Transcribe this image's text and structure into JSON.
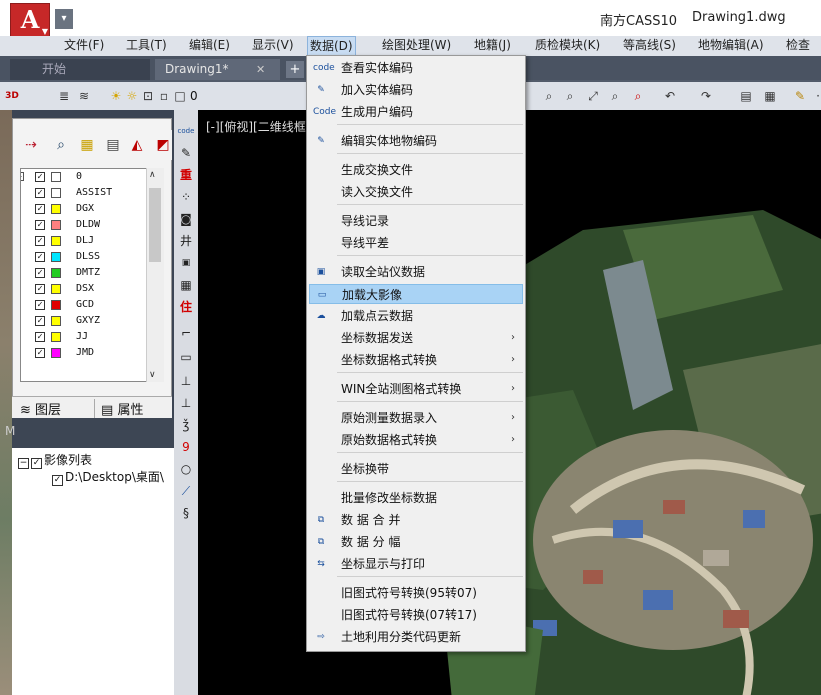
{
  "title_bar": {
    "app_name": "南方CASS10",
    "document": "Drawing1.dwg",
    "app_letter": "A"
  },
  "menu_bar": [
    "文件(F)",
    "工具(T)",
    "编辑(E)",
    "显示(V)",
    "数据(D)",
    "绘图处理(W)",
    "地籍(J)",
    "质检模块(K)",
    "等高线(S)",
    "地物编辑(A)",
    "检查入"
  ],
  "tabs": {
    "start": "开始",
    "drawing": "Drawing1*",
    "close": "✕",
    "add": "+"
  },
  "toolbar": {
    "layer_value": "0"
  },
  "layers": [
    {
      "name": "0",
      "color": "#ffffff"
    },
    {
      "name": "ASSIST",
      "color": "#ffffff"
    },
    {
      "name": "DGX",
      "color": "#ffff00"
    },
    {
      "name": "DLDW",
      "color": "#ff8080"
    },
    {
      "name": "DLJ",
      "color": "#ffff00"
    },
    {
      "name": "DLSS",
      "color": "#00e5ff"
    },
    {
      "name": "DMTZ",
      "color": "#22cc22"
    },
    {
      "name": "DSX",
      "color": "#ffff00"
    },
    {
      "name": "GCD",
      "color": "#e00000"
    },
    {
      "name": "GXYZ",
      "color": "#ffff00"
    },
    {
      "name": "JJ",
      "color": "#ffff00"
    },
    {
      "name": "JMD",
      "color": "#ff00ff"
    }
  ],
  "panel_tabs": {
    "layers": "图层",
    "properties": "属性"
  },
  "panel_gap_label": "M",
  "image_panel": {
    "root": "影像列表",
    "item": "D:\\Desktop\\桌面\\"
  },
  "canvas": {
    "view_label": "[-][俯视][二维线框]"
  },
  "dropdown": {
    "items": [
      {
        "label": "查看实体编码",
        "icon": "code-search-icon",
        "icon_glyph": "code"
      },
      {
        "label": "加入实体编码",
        "icon": "code-add-icon",
        "icon_glyph": "✎"
      },
      {
        "label": "生成用户编码",
        "icon": "code-generate-icon",
        "icon_glyph": "Code"
      },
      {
        "label": "编辑实体地物编码",
        "icon": "code-edit-icon",
        "icon_glyph": "✎"
      },
      {
        "label": "生成交换文件",
        "icon": "",
        "icon_glyph": ""
      },
      {
        "label": "读入交换文件",
        "icon": "",
        "icon_glyph": ""
      },
      {
        "label": "导线记录",
        "icon": "",
        "icon_glyph": ""
      },
      {
        "label": "导线平差",
        "icon": "",
        "icon_glyph": ""
      },
      {
        "label": "读取全站仪数据",
        "icon": "total-station-icon",
        "icon_glyph": "▣"
      },
      {
        "label": "加载大影像",
        "icon": "load-image-icon",
        "icon_glyph": "▭"
      },
      {
        "label": "加载点云数据",
        "icon": "point-cloud-icon",
        "icon_glyph": "☁"
      },
      {
        "label": "坐标数据发送",
        "icon": "",
        "icon_glyph": "",
        "submenu": true
      },
      {
        "label": "坐标数据格式转换",
        "icon": "",
        "icon_glyph": "",
        "submenu": true
      },
      {
        "label": "WIN全站测图格式转换",
        "icon": "",
        "icon_glyph": "",
        "submenu": true
      },
      {
        "label": "原始测量数据录入",
        "icon": "",
        "icon_glyph": "",
        "submenu": true
      },
      {
        "label": "原始数据格式转换",
        "icon": "",
        "icon_glyph": "",
        "submenu": true
      },
      {
        "label": "坐标换带",
        "icon": "",
        "icon_glyph": ""
      },
      {
        "label": "批量修改坐标数据",
        "icon": "",
        "icon_glyph": ""
      },
      {
        "label": "数 据 合 并",
        "icon": "data-merge-icon",
        "icon_glyph": "⧉"
      },
      {
        "label": "数 据 分 幅",
        "icon": "data-split-icon",
        "icon_glyph": "⧉"
      },
      {
        "label": "坐标显示与打印",
        "icon": "coord-print-icon",
        "icon_glyph": "⇆"
      },
      {
        "label": "旧图式符号转换(95转07)",
        "icon": "",
        "icon_glyph": ""
      },
      {
        "label": "旧图式符号转换(07转17)",
        "icon": "",
        "icon_glyph": ""
      },
      {
        "label": "土地利用分类代码更新",
        "icon": "land-code-icon",
        "icon_glyph": "⇨"
      }
    ],
    "highlighted_index": 9,
    "submenu_arrow": "›"
  }
}
